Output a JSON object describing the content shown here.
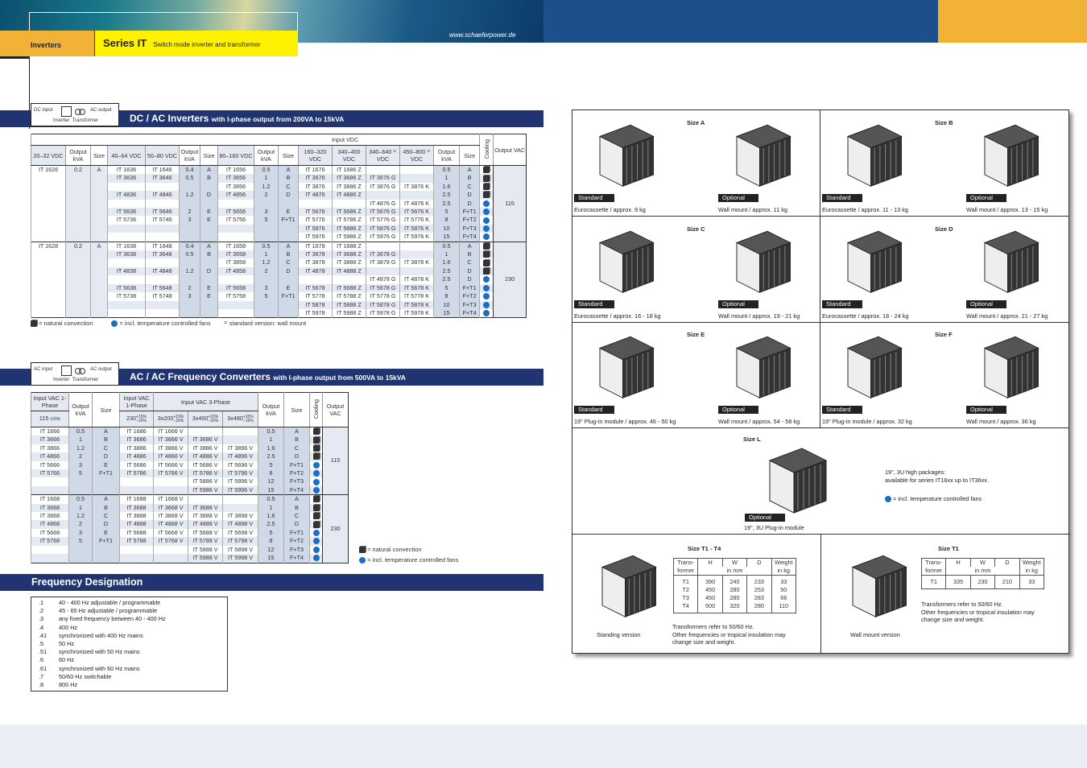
{
  "header": {
    "category": "Inverters",
    "series": "Series IT",
    "subtitle": "Switch mode inverter and transformer",
    "url": "www.schaeferpower.de"
  },
  "colors": {
    "bar": "#1f3470",
    "orange": "#f2b236",
    "yellow": "#fff200",
    "fan": "#1a6fc4"
  },
  "dc": {
    "schematic": {
      "input": "DC input",
      "output": "AC output",
      "inverter": "Inverter",
      "transformer": "Transformer"
    },
    "title": "DC / AC Inverters",
    "title_small": "with I-phase output from 200VA to 15kVA",
    "group_header": "Input VDC",
    "headers": [
      "20–32 VDC",
      "Output kVA",
      "Size",
      "40–64 VDC",
      "50–80 VDC",
      "Output kVA",
      "Size",
      "80–160 VDC",
      "Output kVA",
      "Size",
      "160–320 VDC",
      "340–400 VDC",
      "340–640 ¹⁾ VDC",
      "450–800 ¹⁾ VDC",
      "Output kVA",
      "Size",
      "Cooling",
      "Output VAC"
    ],
    "groups": [
      {
        "lead": [
          "IT 1626",
          "0.2",
          "A"
        ],
        "vac": "115",
        "rows": [
          [
            "IT 1636",
            "IT 1646",
            "0.4",
            "A",
            "IT 1656",
            "0.5",
            "A",
            "IT 1676",
            "IT 1686 Z",
            "",
            "",
            "0.5",
            "A",
            "conv"
          ],
          [
            "IT 3636",
            "IT 3646",
            "0.5",
            "B",
            "IT 3656",
            "1",
            "B",
            "IT 3676",
            "IT 3686 Z",
            "IT 3676 G",
            "",
            "1",
            "B",
            "conv"
          ],
          [
            "",
            "",
            "",
            "",
            "IT 3856",
            "1.2",
            "C",
            "IT 3876",
            "IT 3886 Z",
            "IT 3876 G",
            "IT 3876 K",
            "1.6",
            "C",
            "conv"
          ],
          [
            "IT 4836",
            "IT 4846",
            "1.2",
            "D",
            "IT 4856",
            "2",
            "D",
            "IT 4876",
            "IT 4886 Z",
            "",
            "",
            "2.5",
            "D",
            "conv"
          ],
          [
            "",
            "",
            "",
            "",
            "",
            "",
            "",
            "",
            "",
            "IT 4876 G",
            "IT 4876 K",
            "2.5",
            "D",
            "fan"
          ],
          [
            "IT 5636",
            "IT 5646",
            "2",
            "E",
            "IT 5656",
            "3",
            "E",
            "IT 5676",
            "IT 5686 Z",
            "IT 5676 G",
            "IT 5676 K",
            "5",
            "F+T1",
            "fan"
          ],
          [
            "IT 5736",
            "IT 5746",
            "3",
            "E",
            "IT 5756",
            "5",
            "F+T1",
            "IT 5776",
            "IT 5786 Z",
            "IT 5776 G",
            "IT 5776 K",
            "8",
            "F+T2",
            "fan"
          ],
          [
            "",
            "",
            "",
            "",
            "",
            "",
            "",
            "IT 5876",
            "IT 5886 Z",
            "IT 5876 G",
            "IT 5876 K",
            "10",
            "F+T3",
            "fan"
          ],
          [
            "",
            "",
            "",
            "",
            "",
            "",
            "",
            "IT 5976",
            "IT 5986 Z",
            "IT 5976 G",
            "IT 5976 K",
            "15",
            "F+T4",
            "fan"
          ]
        ]
      },
      {
        "lead": [
          "IT 1628",
          "0.2",
          "A"
        ],
        "vac": "230",
        "rows": [
          [
            "IT 1638",
            "IT 1648",
            "0.4",
            "A",
            "IT 1658",
            "0.5",
            "A",
            "IT 1678",
            "IT 1688 Z",
            "",
            "",
            "0.5",
            "A",
            "conv"
          ],
          [
            "IT 3638",
            "IT 3648",
            "0.5",
            "B",
            "IT 3658",
            "1",
            "B",
            "IT 3678",
            "IT 3688 Z",
            "IT 3678 G",
            "",
            "1",
            "B",
            "conv"
          ],
          [
            "",
            "",
            "",
            "",
            "IT 3858",
            "1.2",
            "C",
            "IT 3878",
            "IT 3888 Z",
            "IT 3878 G",
            "IT 3878 K",
            "1.6",
            "C",
            "conv"
          ],
          [
            "IT 4838",
            "IT 4848",
            "1.2",
            "D",
            "IT 4858",
            "2",
            "D",
            "IT 4878",
            "IT 4888 Z",
            "",
            "",
            "2.5",
            "D",
            "conv"
          ],
          [
            "",
            "",
            "",
            "",
            "",
            "",
            "",
            "",
            "",
            "IT 4878 G",
            "IT 4878 K",
            "2.5",
            "D",
            "fan"
          ],
          [
            "IT 5638",
            "IT 5648",
            "2",
            "E",
            "IT 5658",
            "3",
            "E",
            "IT 5678",
            "IT 5688 Z",
            "IT 5678 G",
            "IT 5678 K",
            "5",
            "F+T1",
            "fan"
          ],
          [
            "IT 5738",
            "IT 5748",
            "3",
            "E",
            "IT 5758",
            "5",
            "F+T1",
            "IT 5778",
            "IT 5788 Z",
            "IT 5778 G",
            "IT 5778 K",
            "8",
            "F+T2",
            "fan"
          ],
          [
            "",
            "",
            "",
            "",
            "",
            "",
            "",
            "IT 5878",
            "IT 5888 Z",
            "IT 5878 G",
            "IT 5878 K",
            "10",
            "F+T3",
            "fan"
          ],
          [
            "",
            "",
            "",
            "",
            "",
            "",
            "",
            "IT 5978",
            "IT 5988 Z",
            "IT 5978 G",
            "IT 5978 K",
            "15",
            "F+T4",
            "fan"
          ]
        ]
      }
    ],
    "legend": {
      "conv": "= natural convection",
      "fan": "= incl. temperature controlled fans",
      "note": "¹⁾  standard version: wall mount"
    }
  },
  "ac": {
    "schematic": {
      "input": "AC input",
      "output": "AC output",
      "inverter": "Inverter",
      "transformer": "Transformer"
    },
    "title": "AC / AC Frequency Converters",
    "title_small": "with I-phase output from 500VA to 15kVA",
    "h": {
      "in1": "Input VAC 1-Phase",
      "kva": "Output kVA",
      "size": "Size",
      "in1b": "Input VAC 1-Phase",
      "in3": "Input VAC 3-Phase",
      "kva2": "Output kVA",
      "size2": "Size",
      "cooling": "Cooling",
      "vac": "Output VAC",
      "v115": "115",
      "t115": "±20%",
      "v230": "230",
      "v3x200": "3x200",
      "v3x400": "3x400",
      "v3x480": "3x480",
      "tol15": "+15%",
      "tol20": "−20%",
      "tol10": "+10%",
      "tol15m": "−15%"
    },
    "groups": [
      {
        "vac": "115",
        "rows": [
          [
            "IT 1666",
            "0.5",
            "A",
            "IT 1686",
            "IT 1666 V",
            "",
            "",
            "0.5",
            "A",
            "conv"
          ],
          [
            "IT 3666",
            "1",
            "B",
            "IT 3686",
            "IT 3666 V",
            "IT 3686 V",
            "",
            "1",
            "B",
            "conv"
          ],
          [
            "IT 3866",
            "1.2",
            "C",
            "IT 3886",
            "IT 3866 V",
            "IT 3886 V",
            "IT 3896 V",
            "1.6",
            "C",
            "conv"
          ],
          [
            "IT 4866",
            "2",
            "D",
            "IT 4886",
            "IT 4866 V",
            "IT 4886 V",
            "IT 4896 V",
            "2.5",
            "D",
            "conv"
          ],
          [
            "IT 5666",
            "3",
            "E",
            "IT 5686",
            "IT 5666 V",
            "IT 5686 V",
            "IT 5696 V",
            "5",
            "F+T1",
            "fan"
          ],
          [
            "IT 5766",
            "5",
            "F+T1",
            "IT 5786",
            "IT 5766 V",
            "IT 5786 V",
            "IT 5796 V",
            "8",
            "F+T2",
            "fan"
          ],
          [
            "",
            "",
            "",
            "",
            "",
            "IT 5886 V",
            "IT 5896 V",
            "12",
            "F+T3",
            "fan"
          ],
          [
            "",
            "",
            "",
            "",
            "",
            "IT 5986 V",
            "IT 5996 V",
            "15",
            "F+T4",
            "fan"
          ]
        ]
      },
      {
        "vac": "230",
        "rows": [
          [
            "IT 1668",
            "0.5",
            "A",
            "IT 1688",
            "IT 1668 V",
            "",
            "",
            "0.5",
            "A",
            "conv"
          ],
          [
            "IT 3668",
            "1",
            "B",
            "IT 3688",
            "IT 3668 V",
            "IT 3688 V",
            "",
            "1",
            "B",
            "conv"
          ],
          [
            "IT 3868",
            "1.2",
            "C",
            "IT 3888",
            "IT 3868 V",
            "IT 3888 V",
            "IT 3898 V",
            "1.6",
            "C",
            "conv"
          ],
          [
            "IT 4868",
            "2",
            "D",
            "IT 4888",
            "IT 4868 V",
            "IT 4888 V",
            "IT 4898 V",
            "2.5",
            "D",
            "conv"
          ],
          [
            "IT 5668",
            "3",
            "E",
            "IT 5688",
            "IT 5668 V",
            "IT 5688 V",
            "IT 5698 V",
            "5",
            "F+T1",
            "fan"
          ],
          [
            "IT 5768",
            "5",
            "F+T1",
            "IT 5788",
            "IT 5768 V",
            "IT 5788 V",
            "IT 5798 V",
            "8",
            "F+T2",
            "fan"
          ],
          [
            "",
            "",
            "",
            "",
            "",
            "IT 5888 V",
            "IT 5898 V",
            "12",
            "F+T3",
            "fan"
          ],
          [
            "",
            "",
            "",
            "",
            "",
            "IT 5988 V",
            "IT 5998 V",
            "15",
            "F+T4",
            "fan"
          ]
        ]
      }
    ],
    "legend": {
      "conv": "= natural convection",
      "fan": "= incl. temperature controlled fans"
    }
  },
  "freq": {
    "title": "Frequency Designation",
    "items": [
      [
        ".1",
        "40 - 400 Hz adjustable / programmable"
      ],
      [
        ".2",
        "45 - 65 Hz adjustable / programmable"
      ],
      [
        ".3",
        "any fixed frequency between 40 - 400 Hz"
      ],
      [
        ".4",
        "400 Hz"
      ],
      [
        ".41",
        "synchronized with 400 Hz mains"
      ],
      [
        ".5",
        "50 Hz"
      ],
      [
        ".51",
        "synchronized with 50 Hz mains"
      ],
      [
        ".6",
        "60 Hz"
      ],
      [
        ".61",
        "synchronized with 60 Hz mains"
      ],
      [
        ".7",
        "50/60 Hz switchable"
      ],
      [
        ".8",
        "800 Hz"
      ]
    ]
  },
  "sizes": [
    {
      "name": "Size A",
      "std": "Standard",
      "opt": "Optional",
      "std_cap": "Eurocassette / approx. 9 kg",
      "opt_cap": "Wall mount / approx. 11 kg"
    },
    {
      "name": "Size B",
      "std": "Standard",
      "opt": "Optional",
      "std_cap": "Eurocassette / approx. 11 - 13 kg",
      "opt_cap": "Wall mount / approx. 13 - 15 kg"
    },
    {
      "name": "Size C",
      "std": "Standard",
      "opt": "Optional",
      "std_cap": "Eurocassette / approx. 16 - 18 kg",
      "opt_cap": "Wall mount / approx. 19 - 21 kg"
    },
    {
      "name": "Size D",
      "std": "Standard",
      "opt": "Optional",
      "std_cap": "Eurocassette / approx. 18 - 24 kg",
      "opt_cap": "Wall mount / approx. 21 - 27 kg"
    },
    {
      "name": "Size E",
      "std": "Standard",
      "opt": "Optional",
      "std_cap": "19\" Plug-in module / approx. 46 - 50 kg",
      "opt_cap": "Wall mount / approx. 54 - 58 kg"
    },
    {
      "name": "Size F",
      "std": "Standard",
      "opt": "Optional",
      "std_cap": "19\" Plug-in module / approx. 32 kg",
      "opt_cap": "Wall mount / approx. 36 kg"
    }
  ],
  "sizeL": {
    "name": "Size L",
    "opt": "Optional",
    "cap": "19\", 3U Plug-in module",
    "note1": "19\", 3U high packages:",
    "note2": "available for series IT16xx up to IT36xx.",
    "fan": "= incl. temperature controlled fans"
  },
  "transformers": {
    "standing": {
      "title": "Size T1 - T4",
      "caption": "Standing version",
      "headers": [
        "Trans-former",
        "H",
        "W",
        "D",
        "Weight in kg"
      ],
      "unit": "in mm",
      "rows": [
        [
          "T1",
          "390",
          "240",
          "233",
          "33"
        ],
        [
          "T2",
          "450",
          "280",
          "253",
          "50"
        ],
        [
          "T3",
          "450",
          "280",
          "283",
          "66"
        ],
        [
          "T4",
          "500",
          "320",
          "280",
          "110"
        ]
      ]
    },
    "wall": {
      "title": "Size T1",
      "caption": "Wall mount version",
      "headers": [
        "Trans-former",
        "H",
        "W",
        "D",
        "Weight in kg"
      ],
      "unit": "in mm",
      "rows": [
        [
          "T1",
          "335",
          "230",
          "210",
          "33"
        ]
      ]
    },
    "note": [
      "Transformers refer to 50/60 Hz.",
      "Other frequencies or tropical insulation may",
      "change size and weight."
    ]
  }
}
